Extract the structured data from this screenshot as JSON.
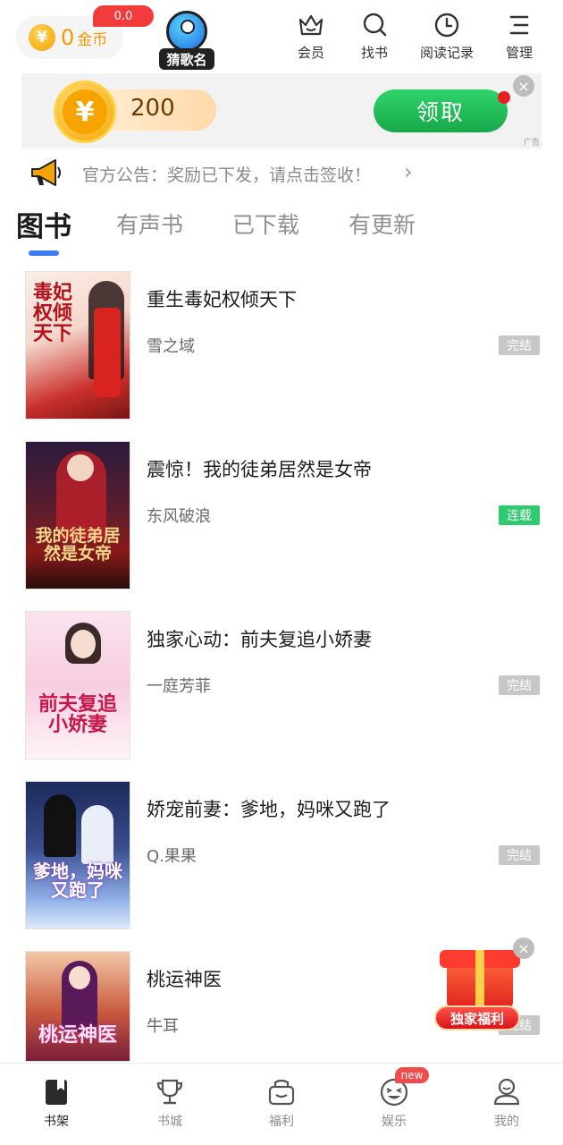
{
  "header": {
    "coins": {
      "value": "0",
      "unit": "金币",
      "badge": "0.0",
      "icon": "yuan-coin-icon"
    },
    "game": {
      "label": "猜歌名",
      "icon": "microphone-icon"
    },
    "nav": [
      {
        "label": "会员",
        "icon": "crown-icon"
      },
      {
        "label": "找书",
        "icon": "search-icon"
      },
      {
        "label": "阅读记录",
        "icon": "clock-icon"
      },
      {
        "label": "管理",
        "icon": "menu-icon"
      }
    ]
  },
  "ad": {
    "coin_symbol": "¥",
    "amount": "200",
    "claim_label": "领取",
    "tag": "广告",
    "close": "×"
  },
  "notice": {
    "text": "官方公告：奖励已下发，请点击签收！",
    "arrow": "›",
    "icon": "megaphone-icon"
  },
  "tabs": [
    {
      "label": "图书",
      "active": true
    },
    {
      "label": "有声书",
      "active": false
    },
    {
      "label": "已下载",
      "active": false
    },
    {
      "label": "有更新",
      "active": false
    }
  ],
  "books": [
    {
      "title": "重生毒妃权倾天下",
      "author": "雪之域",
      "status": "完结",
      "status_color": "#c7c7c7",
      "cover_text": "毒妃权倾天下"
    },
    {
      "title": "震惊！我的徒弟居然是女帝",
      "author": "东风破浪",
      "status": "连载",
      "status_color": "#2fcc6f",
      "cover_text": "我的徒弟居然是女帝"
    },
    {
      "title": "独家心动：前夫复追小娇妻",
      "author": "一庭芳菲",
      "status": "完结",
      "status_color": "#c7c7c7",
      "cover_text": "前夫复追小娇妻"
    },
    {
      "title": "娇宠前妻：爹地，妈咪又跑了",
      "author": "Q.果果",
      "status": "完结",
      "status_color": "#c7c7c7",
      "cover_text": "爹地，妈咪又跑了"
    },
    {
      "title": "桃运神医",
      "author": "牛耳",
      "status": "完结",
      "status_color": "#c7c7c7",
      "cover_text": "桃运神医"
    }
  ],
  "promo": {
    "label": "独家福利",
    "close": "×",
    "icon": "gift-box-icon"
  },
  "bottom_nav": [
    {
      "label": "书架",
      "icon": "bookshelf-icon",
      "active": true
    },
    {
      "label": "书城",
      "icon": "trophy-icon",
      "active": false
    },
    {
      "label": "福利",
      "icon": "gift-basket-icon",
      "active": false
    },
    {
      "label": "娱乐",
      "icon": "smile-face-icon",
      "active": false,
      "badge": "new"
    },
    {
      "label": "我的",
      "icon": "user-icon",
      "active": false
    }
  ],
  "colors": {
    "accent_blue": "#3a7cf2",
    "coin_orange": "#f29a00",
    "claim_green": "#17a84a",
    "badge_red": "#f23b3b"
  }
}
